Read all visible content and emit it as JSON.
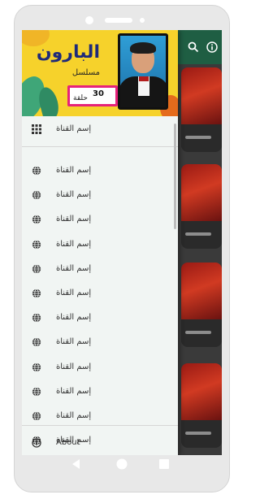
{
  "drawer": {
    "banner": {
      "title": "البارون",
      "subtitle": "مسلسل",
      "badge_number": "30",
      "badge_label": "حلقة"
    },
    "header_item": {
      "label": "إسم القناة",
      "icon": "grid-icon"
    },
    "items": [
      {
        "label": "إسم القناة",
        "icon": "globe-icon"
      },
      {
        "label": "إسم القناة",
        "icon": "globe-icon"
      },
      {
        "label": "إسم القناة",
        "icon": "globe-icon"
      },
      {
        "label": "إسم القناة",
        "icon": "globe-icon"
      },
      {
        "label": "إسم القناة",
        "icon": "globe-icon"
      },
      {
        "label": "إسم القناة",
        "icon": "globe-icon"
      },
      {
        "label": "إسم القناة",
        "icon": "globe-icon"
      },
      {
        "label": "إسم القناة",
        "icon": "globe-icon"
      },
      {
        "label": "إسم القناة",
        "icon": "globe-icon"
      },
      {
        "label": "إسم القناة",
        "icon": "globe-icon"
      },
      {
        "label": "إسم القناة",
        "icon": "globe-icon"
      },
      {
        "label": "إسم القناة",
        "icon": "globe-icon"
      }
    ],
    "footer_item": {
      "label": "About",
      "icon": "info-icon"
    }
  },
  "appbar": {
    "icons": [
      "search-icon",
      "info-icon"
    ]
  },
  "navbar": {
    "icons": [
      "back-icon",
      "home-icon",
      "recents-icon"
    ]
  },
  "colors": {
    "appbar": "#1f5e43",
    "drawer_bg": "#f1f5f3",
    "banner_bg": "#f6d22b",
    "badge_border": "#e6227a",
    "phone_frame": "#e8e8e8"
  }
}
